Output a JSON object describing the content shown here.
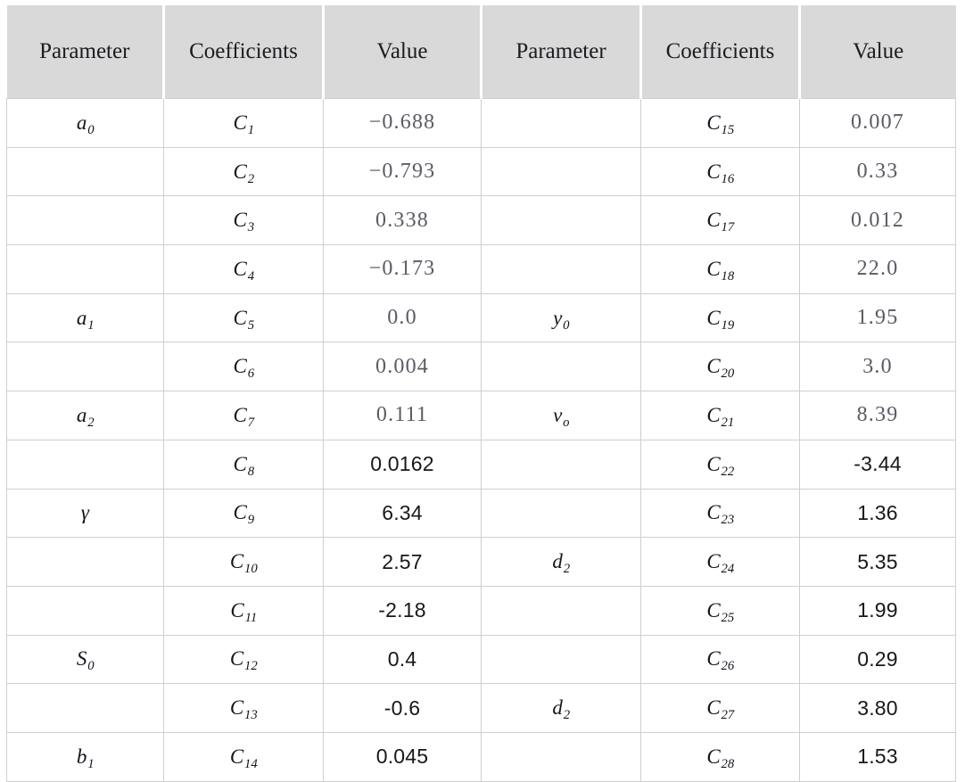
{
  "table": {
    "headers": [
      "Parameter",
      "Coefficients",
      "Value",
      "Parameter",
      "Coefficients",
      "Value"
    ],
    "header_background": "#d9d9d9",
    "border_color": "#cfcfcf",
    "value_style_math_color": "#5b5b66",
    "value_style_sans_color": "#181818",
    "left_rows": [
      {
        "parameter": "a",
        "parameter_sub": "0",
        "coefficient": "C",
        "coefficient_sub": "1",
        "value": "−0.688",
        "value_style": "math"
      },
      {
        "parameter": "",
        "parameter_sub": "",
        "coefficient": "C",
        "coefficient_sub": "2",
        "value": "−0.793",
        "value_style": "math"
      },
      {
        "parameter": "",
        "parameter_sub": "",
        "coefficient": "C",
        "coefficient_sub": "3",
        "value": "0.338",
        "value_style": "math"
      },
      {
        "parameter": "",
        "parameter_sub": "",
        "coefficient": "C",
        "coefficient_sub": "4",
        "value": "−0.173",
        "value_style": "math"
      },
      {
        "parameter": "a",
        "parameter_sub": "1",
        "coefficient": "C",
        "coefficient_sub": "5",
        "value": "0.0",
        "value_style": "math"
      },
      {
        "parameter": "",
        "parameter_sub": "",
        "coefficient": "C",
        "coefficient_sub": "6",
        "value": "0.004",
        "value_style": "math"
      },
      {
        "parameter": "a",
        "parameter_sub": "2",
        "coefficient": "C",
        "coefficient_sub": "7",
        "value": "0.111",
        "value_style": "math"
      },
      {
        "parameter": "",
        "parameter_sub": "",
        "coefficient": "C",
        "coefficient_sub": "8",
        "value": "0.0162",
        "value_style": "sans"
      },
      {
        "parameter": "γ",
        "parameter_sub": "",
        "coefficient": "C",
        "coefficient_sub": "9",
        "value": "6.34",
        "value_style": "sans"
      },
      {
        "parameter": "",
        "parameter_sub": "",
        "coefficient": "C",
        "coefficient_sub": "10",
        "value": "2.57",
        "value_style": "sans"
      },
      {
        "parameter": "",
        "parameter_sub": "",
        "coefficient": "C",
        "coefficient_sub": "11",
        "value": "-2.18",
        "value_style": "sans"
      },
      {
        "parameter": "S",
        "parameter_sub": "0",
        "coefficient": "C",
        "coefficient_sub": "12",
        "value": "0.4",
        "value_style": "sans"
      },
      {
        "parameter": "",
        "parameter_sub": "",
        "coefficient": "C",
        "coefficient_sub": "13",
        "value": "-0.6",
        "value_style": "sans"
      },
      {
        "parameter": "b",
        "parameter_sub": "1",
        "coefficient": "C",
        "coefficient_sub": "14",
        "value": "0.045",
        "value_style": "sans"
      }
    ],
    "right_rows": [
      {
        "parameter": "",
        "parameter_sub": "",
        "coefficient": "C",
        "coefficient_sub": "15",
        "value": "0.007",
        "value_style": "math"
      },
      {
        "parameter": "",
        "parameter_sub": "",
        "coefficient": "C",
        "coefficient_sub": "16",
        "value": "0.33",
        "value_style": "math"
      },
      {
        "parameter": "",
        "parameter_sub": "",
        "coefficient": "C",
        "coefficient_sub": "17",
        "value": "0.012",
        "value_style": "math"
      },
      {
        "parameter": "",
        "parameter_sub": "",
        "coefficient": "C",
        "coefficient_sub": "18",
        "value": "22.0",
        "value_style": "math"
      },
      {
        "parameter": "y",
        "parameter_sub": "0",
        "coefficient": "C",
        "coefficient_sub": "19",
        "value": "1.95",
        "value_style": "math"
      },
      {
        "parameter": "",
        "parameter_sub": "",
        "coefficient": "C",
        "coefficient_sub": "20",
        "value": "3.0",
        "value_style": "math"
      },
      {
        "parameter": "ν",
        "parameter_sub": "o",
        "coefficient": "C",
        "coefficient_sub": "21",
        "value": "8.39",
        "value_style": "math"
      },
      {
        "parameter": "",
        "parameter_sub": "",
        "coefficient": "C",
        "coefficient_sub": "22",
        "value": "-3.44",
        "value_style": "sans"
      },
      {
        "parameter": "",
        "parameter_sub": "",
        "coefficient": "C",
        "coefficient_sub": "23",
        "value": "1.36",
        "value_style": "sans"
      },
      {
        "parameter": "d",
        "parameter_sub": "2",
        "coefficient": "C",
        "coefficient_sub": "24",
        "value": "5.35",
        "value_style": "sans"
      },
      {
        "parameter": "",
        "parameter_sub": "",
        "coefficient": "C",
        "coefficient_sub": "25",
        "value": "1.99",
        "value_style": "sans"
      },
      {
        "parameter": "",
        "parameter_sub": "",
        "coefficient": "C",
        "coefficient_sub": "26",
        "value": "0.29",
        "value_style": "sans"
      },
      {
        "parameter": "d",
        "parameter_sub": "2",
        "coefficient": "C",
        "coefficient_sub": "27",
        "value": "3.80",
        "value_style": "sans"
      },
      {
        "parameter": "",
        "parameter_sub": "",
        "coefficient": "C",
        "coefficient_sub": "28",
        "value": "1.53",
        "value_style": "sans"
      }
    ]
  }
}
